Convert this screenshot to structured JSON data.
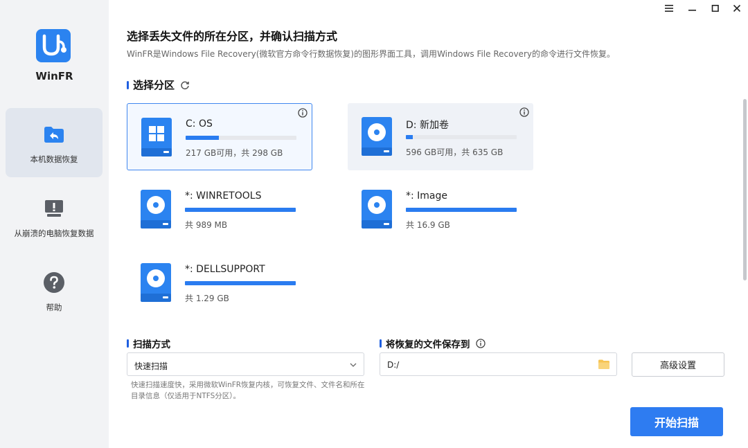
{
  "app": {
    "name": "WinFR",
    "colors": {
      "accent": "#2e7cf1",
      "sidebar_bg": "#f2f3f5",
      "active_item_bg": "#e1e6ee"
    }
  },
  "window_controls": [
    {
      "name": "menu-icon"
    },
    {
      "name": "minimize-icon"
    },
    {
      "name": "maximize-icon"
    },
    {
      "name": "close-icon"
    }
  ],
  "sidebar": {
    "items": [
      {
        "label": "本机数据恢复",
        "icon": "folder-restore-icon",
        "active": true
      },
      {
        "label": "从崩溃的电脑恢复数据",
        "icon": "crashed-pc-icon",
        "active": false
      },
      {
        "label": "帮助",
        "icon": "help-icon",
        "active": false
      }
    ]
  },
  "header": {
    "title": "选择丢失文件的所在分区，并确认扫描方式",
    "subtitle": "WinFR是Windows File Recovery(微软官方命令行数据恢复)的图形界面工具，调用Windows File Recovery的命令进行文件恢复。"
  },
  "partitions_section": {
    "label": "选择分区",
    "refresh_icon": "refresh-icon",
    "partitions": [
      {
        "name": "C: OS",
        "size": "217 GB可用，共 298 GB",
        "used_fraction": 0.3,
        "icon": "windows-drive-icon",
        "selected": true,
        "show_info": true
      },
      {
        "name": "D: 新加卷",
        "size": "596 GB可用，共 635 GB",
        "used_fraction": 0.06,
        "icon": "disk-drive-icon",
        "selected": false,
        "show_info": true
      },
      {
        "name": "*: WINRETOOLS",
        "size": "共 989 MB",
        "used_fraction": 1.0,
        "icon": "disk-drive-icon",
        "selected": false,
        "show_info": false
      },
      {
        "name": "*: Image",
        "size": "共 16.9 GB",
        "used_fraction": 1.0,
        "icon": "disk-drive-icon",
        "selected": false,
        "show_info": false
      },
      {
        "name": "*: DELLSUPPORT",
        "size": "共 1.29 GB",
        "used_fraction": 1.0,
        "icon": "disk-drive-icon",
        "selected": false,
        "show_info": false
      }
    ]
  },
  "scan": {
    "label": "扫描方式",
    "selected": "快速扫描",
    "hint": "快速扫描速度快，采用微软WinFR恢复内核，可恢复文件、文件名和所在目录信息（仅适用于NTFS分区）。"
  },
  "save": {
    "label": "将恢复的文件保存到",
    "path": "D:/"
  },
  "buttons": {
    "advanced": "高级设置",
    "start": "开始扫描"
  }
}
